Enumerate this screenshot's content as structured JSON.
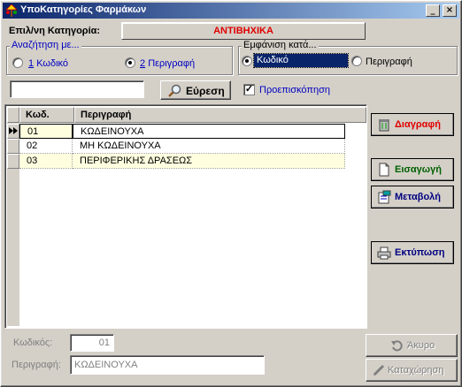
{
  "window": {
    "title": "ΥποΚατηγορίες Φαρμάκων",
    "icon": "pharmacy-tree-icon",
    "controls": [
      "minimize",
      "close"
    ]
  },
  "category": {
    "label": "Επιλ/νη Κατηγορία:",
    "value": "ΑΝΤΙΒΗΧΙΚΑ",
    "value_color": "#e00000"
  },
  "search_group": {
    "legend": "Αναζήτηση με...",
    "options": [
      {
        "number": "1",
        "label": "Κωδικό",
        "selected": false
      },
      {
        "number": "2",
        "label": "Περιγραφή",
        "selected": true
      }
    ]
  },
  "display_group": {
    "legend": "Εμφάνιση κατά...",
    "options": [
      {
        "label": "Κωδικό",
        "selected": true
      },
      {
        "label": "Περιγραφή",
        "selected": false
      }
    ]
  },
  "search": {
    "value": "",
    "button_label": "Εύρεση",
    "preview_label": "Προεπισκόπηση",
    "preview_checked": true
  },
  "grid": {
    "columns": [
      "Κωδ.",
      "Περιγραφή"
    ],
    "rows": [
      {
        "code": "01",
        "description": "ΚΩΔΕΙΝΟΥΧΑ",
        "selected": true
      },
      {
        "code": "02",
        "description": "ΜΗ ΚΩΔΕΙΝΟΥΧΑ",
        "selected": false
      },
      {
        "code": "03",
        "description": "ΠΕΡΙΦΕΡΙΚΗΣ ΔΡΑΣΕΩΣ",
        "selected": false
      }
    ]
  },
  "actions": {
    "delete": {
      "label": "Διαγραφή",
      "color": "#e00000",
      "icon": "trash-icon"
    },
    "insert": {
      "label": "Εισαγωγή",
      "color": "#006000",
      "icon": "new-document-icon"
    },
    "edit": {
      "label": "Μεταβολή",
      "color": "#000080",
      "icon": "edit-document-icon"
    },
    "print": {
      "label": "Εκτύπωση",
      "color": "#000080",
      "icon": "printer-icon"
    }
  },
  "form": {
    "code_label": "Κωδικός:",
    "code_value": "01",
    "description_label": "Περιγραφή:",
    "description_value": "ΚΩΔΕΙΝΟΥΧΑ",
    "cancel_label": "Άκυρο",
    "save_label": "Καταχώρηση"
  }
}
